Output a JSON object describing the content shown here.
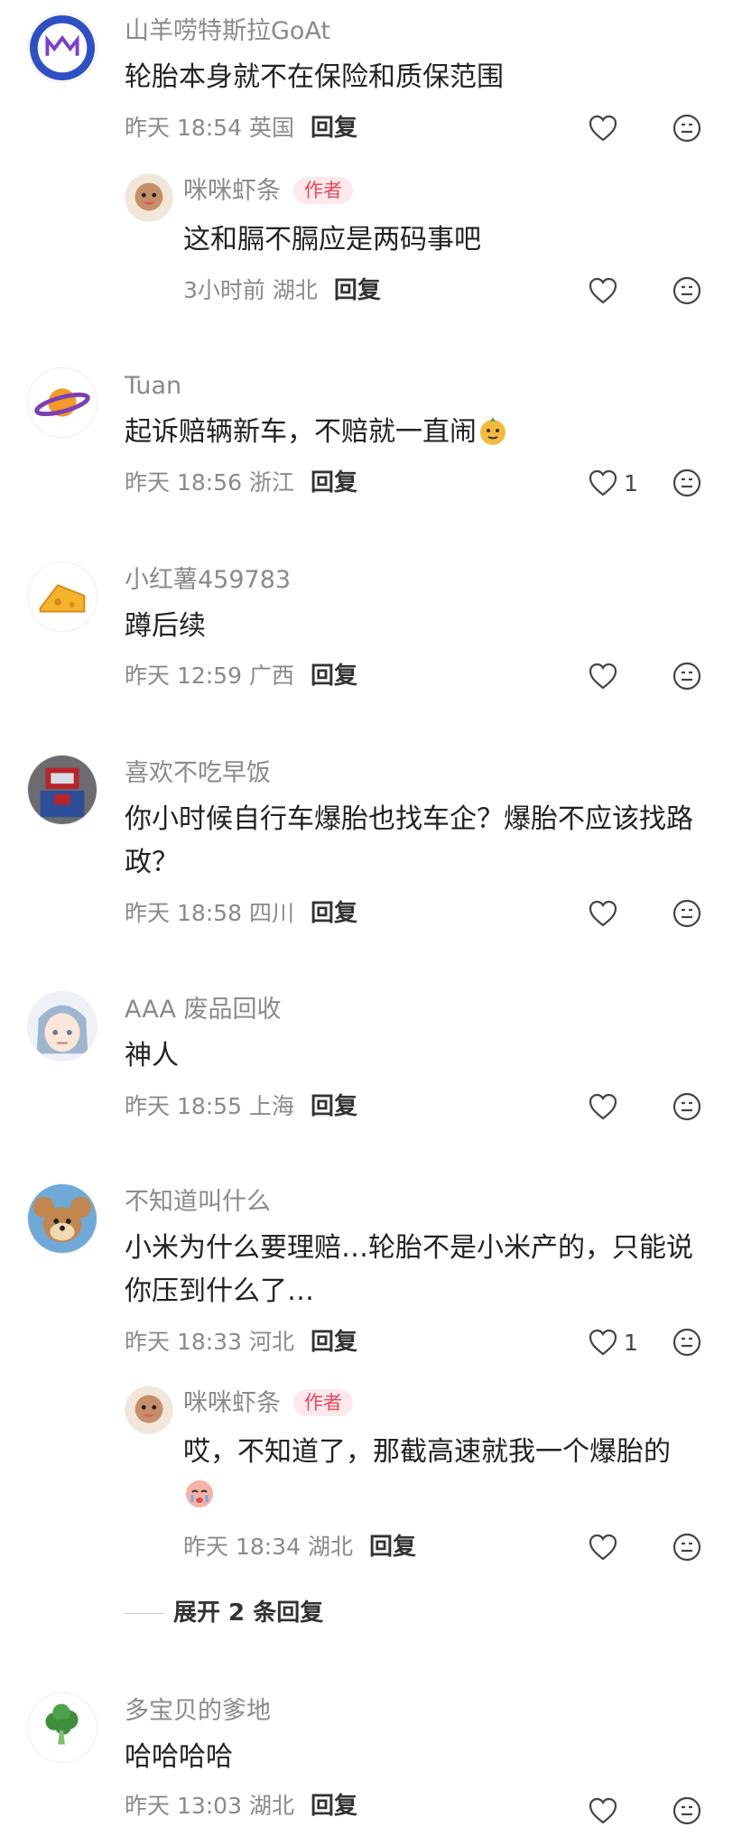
{
  "comments": [
    {
      "user": "山羊唠特斯拉GoAt",
      "text": "轮胎本身就不在保险和质保范围",
      "time": "昨天 18:54 英国",
      "reply": "回复",
      "likes": "",
      "sub": {
        "user": "咪咪虾条",
        "tag": "作者",
        "text": "这和膈不膈应是两码事吧",
        "time": "3小时前 湖北",
        "reply": "回复"
      }
    },
    {
      "user": "Tuan",
      "text": "起诉赔辆新车，不赔就一直闹",
      "time": "昨天 18:56 浙江",
      "reply": "回复",
      "likes": "1"
    },
    {
      "user": "小红薯459783",
      "text": "蹲后续",
      "time": "昨天 12:59 广西",
      "reply": "回复",
      "likes": ""
    },
    {
      "user": "喜欢不吃早饭",
      "text1": "你小时候自行车爆胎也找车企？爆胎不应该找路",
      "text2": "政？",
      "time": "昨天 18:58 四川",
      "reply": "回复",
      "likes": ""
    },
    {
      "user": "AAA 废品回收",
      "text": "神人",
      "time": "昨天 18:55 上海",
      "reply": "回复",
      "likes": ""
    },
    {
      "user": "不知道叫什么",
      "text1": "小米为什么要理赔…轮胎不是小米产的，只能说",
      "text2": "你压到什么了…",
      "time": "昨天 18:33 河北",
      "reply": "回复",
      "likes": "1",
      "sub": {
        "user": "咪咪虾条",
        "tag": "作者",
        "text": "哎，不知道了，那截高速就我一个爆胎的",
        "time": "昨天 18:34 湖北",
        "reply": "回复"
      },
      "expand": "展开 2 条回复"
    },
    {
      "user": "多宝贝的爹地",
      "text": "哈哈哈哈",
      "time": "昨天 13:03 湖北",
      "reply": "回复",
      "likes": ""
    }
  ],
  "icons": {
    "like": "heart-outline-icon",
    "more": "emoji-face-icon"
  }
}
